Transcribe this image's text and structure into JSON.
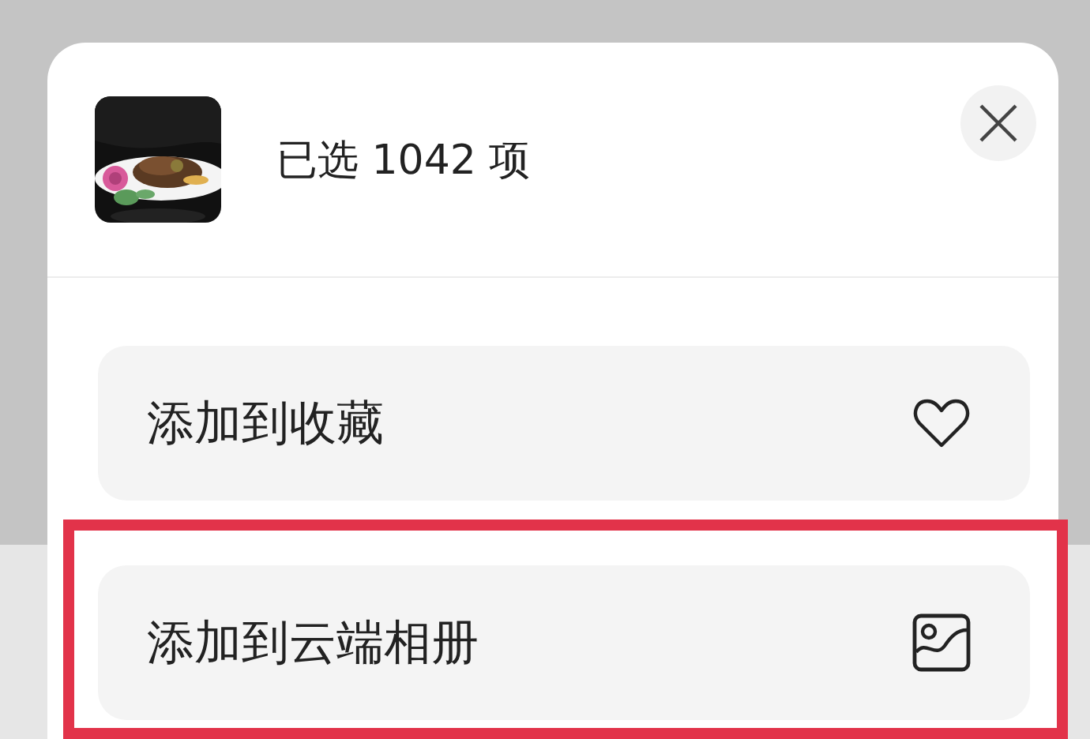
{
  "sheet": {
    "title": "已选 1042 项"
  },
  "items": [
    {
      "label": "添加到收藏",
      "kind": "heart",
      "highlighted": false
    },
    {
      "label": "添加到云端相册",
      "kind": "album",
      "highlighted": true
    }
  ]
}
